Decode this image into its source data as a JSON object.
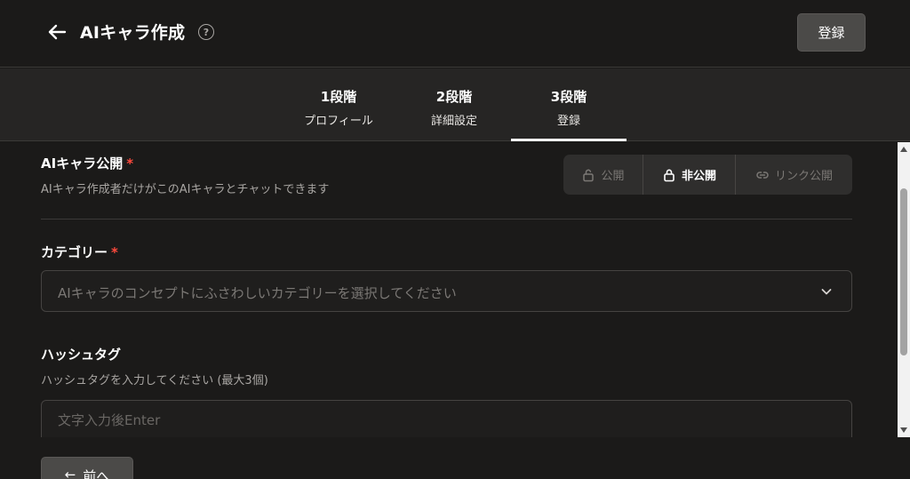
{
  "header": {
    "title": "AIキャラ作成",
    "help": "?",
    "register_label": "登録"
  },
  "steps": [
    {
      "num": "1段階",
      "label": "プロフィール"
    },
    {
      "num": "2段階",
      "label": "詳細設定"
    },
    {
      "num": "3段階",
      "label": "登録"
    }
  ],
  "visibility": {
    "label": "AIキャラ公開",
    "required": "*",
    "desc": "AIキャラ作成者だけがこのAIキャラとチャットできます",
    "options": [
      "公開",
      "非公開",
      "リンク公開"
    ],
    "selected": "非公開"
  },
  "category": {
    "label": "カテゴリー",
    "required": "*",
    "placeholder": "AIキャラのコンセプトにふさわしいカテゴリーを選択してください"
  },
  "hashtag": {
    "label": "ハッシュタグ",
    "desc": "ハッシュタグを入力してください (最大3個)",
    "placeholder": "文字入力後Enter"
  },
  "footer": {
    "prev_arrow": "←",
    "prev_label": "前へ"
  },
  "colors": {
    "background": "#1b1a19",
    "required": "#ff4a3d",
    "button": "#4b4a48"
  }
}
